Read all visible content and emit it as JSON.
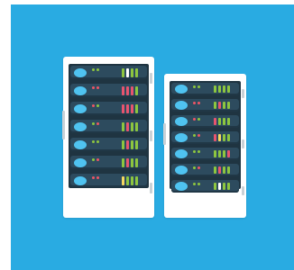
{
  "colors": {
    "background": "#29abe2",
    "cabinet": "#ffffff",
    "rack_frame": "#1f3441",
    "unit": "#2d4b5e",
    "unit_shadow": "#203746",
    "hinge": "#c9d1d6",
    "power_button": "#4fc3f0",
    "led_green": "#8dc63f",
    "led_red": "#ed5565",
    "bar_green": "#8dc63f",
    "bar_red": "#e8546e",
    "bar_yellow": "#f6d860",
    "bar_white": "#ffffff"
  },
  "icons": [
    "server-rack-icon",
    "server-rack-icon"
  ],
  "cabinets": [
    {
      "name": "left",
      "units": [
        {
          "leds": [
            "green",
            "green"
          ],
          "bars": [
            "green",
            "white",
            "green",
            "green"
          ]
        },
        {
          "leds": [
            "red",
            "red"
          ],
          "bars": [
            "red",
            "red",
            "red",
            "green"
          ]
        },
        {
          "leds": [
            "red",
            "green"
          ],
          "bars": [
            "red",
            "red",
            "red",
            "green"
          ]
        },
        {
          "leds": [
            "green",
            "red"
          ],
          "bars": [
            "green",
            "red",
            "green",
            "green"
          ]
        },
        {
          "leds": [
            "green",
            "green"
          ],
          "bars": [
            "green",
            "red",
            "green",
            "green"
          ]
        },
        {
          "leds": [
            "green",
            "red"
          ],
          "bars": [
            "green",
            "red",
            "green",
            "green"
          ]
        },
        {
          "leds": [
            "red",
            "red"
          ],
          "bars": [
            "yellow",
            "green",
            "green",
            "green"
          ]
        }
      ]
    },
    {
      "name": "right",
      "units": [
        {
          "leds": [
            "green",
            "green"
          ],
          "bars": [
            "green",
            "green",
            "green",
            "green"
          ]
        },
        {
          "leds": [
            "red",
            "red"
          ],
          "bars": [
            "green",
            "red",
            "green",
            "green"
          ]
        },
        {
          "leds": [
            "red",
            "green"
          ],
          "bars": [
            "red",
            "green",
            "green",
            "green"
          ]
        },
        {
          "leds": [
            "green",
            "red"
          ],
          "bars": [
            "red",
            "yellow",
            "green",
            "green"
          ]
        },
        {
          "leds": [
            "green",
            "green"
          ],
          "bars": [
            "green",
            "green",
            "green",
            "red"
          ]
        },
        {
          "leds": [
            "green",
            "red"
          ],
          "bars": [
            "green",
            "red",
            "green",
            "green"
          ]
        },
        {
          "leds": [
            "green",
            "green"
          ],
          "bars": [
            "green",
            "white",
            "green",
            "green"
          ]
        }
      ]
    }
  ]
}
